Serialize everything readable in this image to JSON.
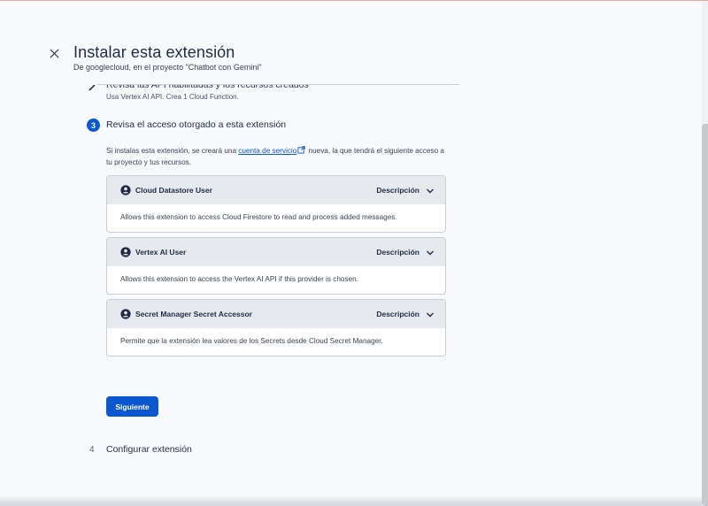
{
  "header": {
    "title": "Instalar esta extensión",
    "subtitle": "De googlecloud, en el proyecto \"Chatbot con Gemini\""
  },
  "step2": {
    "title": "Revisa las API habilitadas y los recursos creados",
    "description": "Usa Vertex AI API. Crea 1 Cloud Function."
  },
  "step3": {
    "number": "3",
    "title": "Revisa el acceso otorgado a esta extensión",
    "intro_before": "Si instalas esta extensión, se creará una ",
    "intro_link": "cuenta de servicio",
    "intro_after": " nueva, la que tendrá el siguiente acceso a tu proyecto y tus recursos.",
    "roles": [
      {
        "name": "Cloud Datastore User",
        "toggle": "Descripción",
        "description": "Allows this extension to access Cloud Firestore to read and process added messages."
      },
      {
        "name": "Vertex AI User",
        "toggle": "Descripción",
        "description": "Allows this extension to access the Vertex AI API if this provider is chosen."
      },
      {
        "name": "Secret Manager Secret Accessor",
        "toggle": "Descripción",
        "description": "Permite que la extensión lea valores de los Secrets desde Cloud Secret Manager."
      }
    ],
    "next_label": "Siguiente"
  },
  "step4": {
    "number": "4",
    "title": "Configurar extensión"
  },
  "colors": {
    "primary": "#0b57d0",
    "card_header": "#e6e9ee",
    "background": "#f7f9fc"
  },
  "icons": {
    "close": "close-icon",
    "step2": "chevron-right-icon",
    "external": "external-link-icon",
    "role": "person-icon",
    "expand": "chevron-down-icon"
  }
}
